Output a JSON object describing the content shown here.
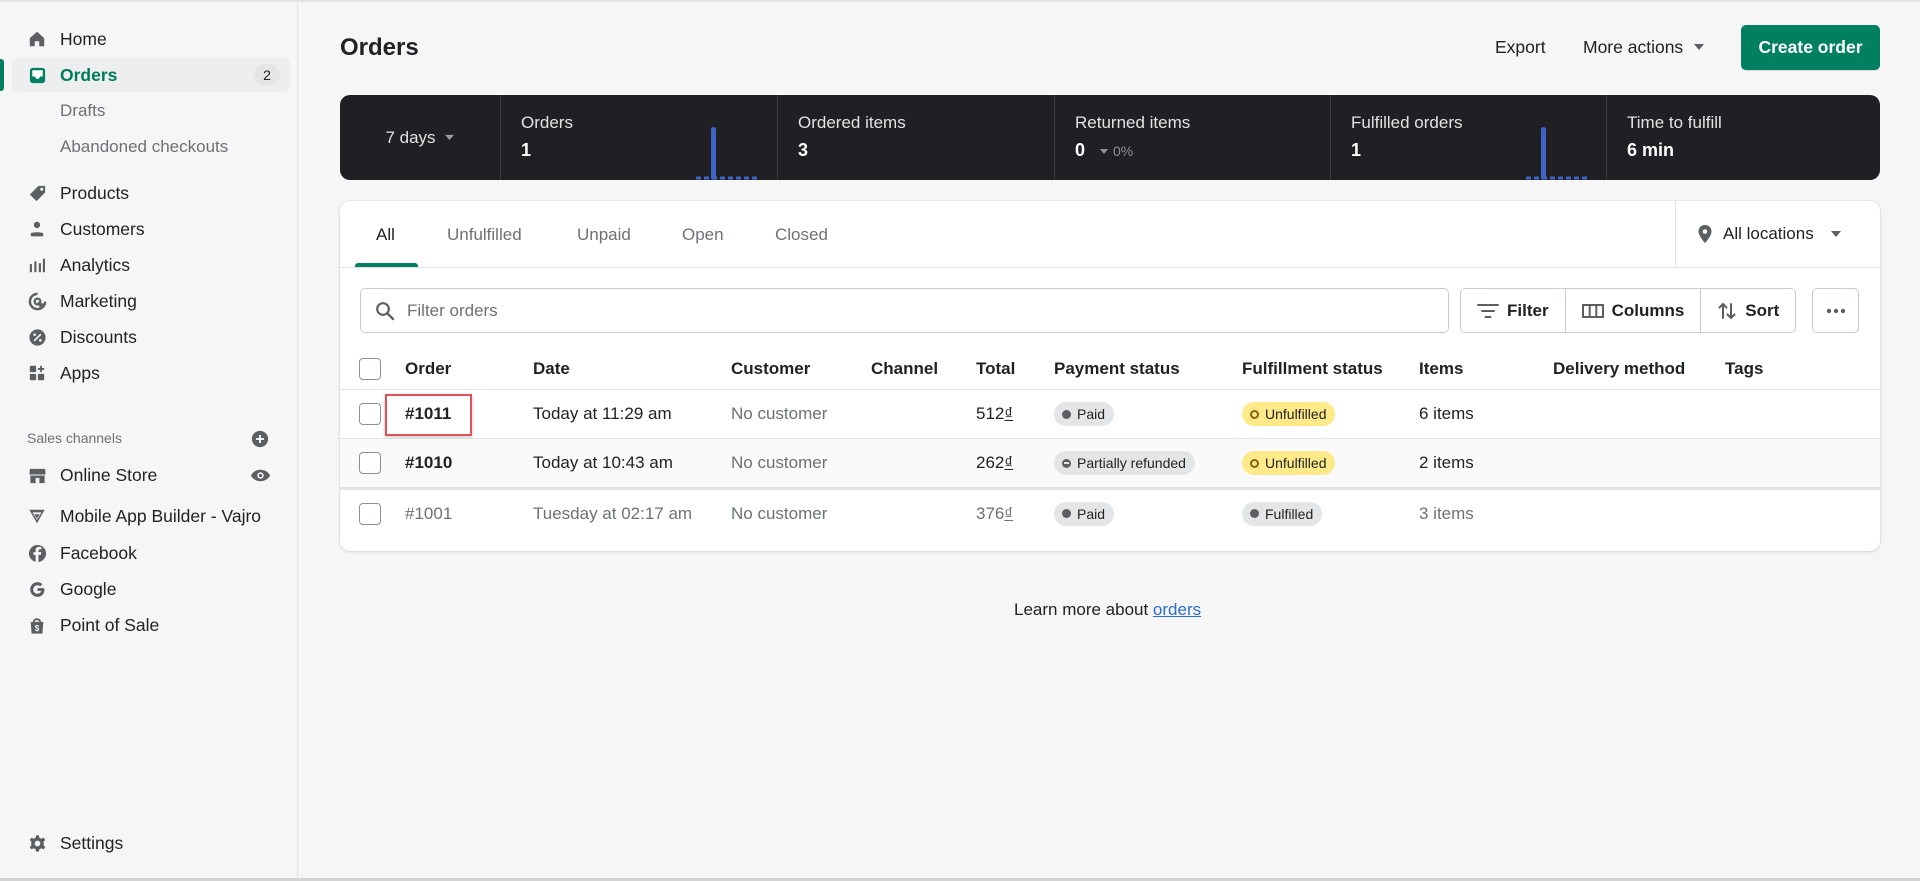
{
  "sidebar": {
    "items": [
      {
        "label": "Home",
        "icon": "home-icon"
      },
      {
        "label": "Orders",
        "icon": "orders-icon",
        "badge": "2",
        "active": true
      },
      {
        "label": "Products",
        "icon": "tag-icon"
      },
      {
        "label": "Customers",
        "icon": "person-icon"
      },
      {
        "label": "Analytics",
        "icon": "bar-chart-icon"
      },
      {
        "label": "Marketing",
        "icon": "target-icon"
      },
      {
        "label": "Discounts",
        "icon": "discount-icon"
      },
      {
        "label": "Apps",
        "icon": "apps-icon"
      }
    ],
    "order_subitems": [
      "Drafts",
      "Abandoned checkouts"
    ],
    "sales_channels_label": "Sales channels",
    "channels": [
      {
        "label": "Online Store",
        "icon": "store-icon"
      },
      {
        "label": "Mobile App Builder - Vajro",
        "icon": "vajro-icon"
      },
      {
        "label": "Facebook",
        "icon": "facebook-icon"
      },
      {
        "label": "Google",
        "icon": "google-icon"
      },
      {
        "label": "Point of Sale",
        "icon": "pos-bag-icon"
      }
    ],
    "settings_label": "Settings"
  },
  "header": {
    "title": "Orders",
    "export_label": "Export",
    "more_actions_label": "More actions",
    "create_label": "Create order"
  },
  "stats": {
    "range_label": "7 days",
    "cards": [
      {
        "label": "Orders",
        "value": "1"
      },
      {
        "label": "Ordered items",
        "value": "3"
      },
      {
        "label": "Returned items",
        "value": "0",
        "delta": "0%"
      },
      {
        "label": "Fulfilled orders",
        "value": "1"
      },
      {
        "label": "Time to fulfill",
        "value": "6 min"
      }
    ],
    "spark_color": "#3f64c9"
  },
  "tabs": [
    {
      "label": "All",
      "active": true
    },
    {
      "label": "Unfulfilled"
    },
    {
      "label": "Unpaid"
    },
    {
      "label": "Open"
    },
    {
      "label": "Closed"
    }
  ],
  "location_label": "All locations",
  "search": {
    "placeholder": "Filter orders",
    "value": ""
  },
  "toolbar": {
    "filter_label": "Filter",
    "columns_label": "Columns",
    "sort_label": "Sort"
  },
  "table": {
    "columns": [
      "Order",
      "Date",
      "Customer",
      "Channel",
      "Total",
      "Payment status",
      "Fulfillment status",
      "Items",
      "Delivery method",
      "Tags"
    ],
    "rows": [
      {
        "order": "#1011",
        "date": "Today at 11:29 am",
        "customer": "No customer",
        "channel": "",
        "total": "512",
        "currency": "₫",
        "payment": "Paid",
        "fulfillment": "Unfulfilled",
        "items": "6 items",
        "delivery": "",
        "tags": ""
      },
      {
        "order": "#1010",
        "date": "Today at 10:43 am",
        "customer": "No customer",
        "channel": "",
        "total": "262",
        "currency": "₫",
        "payment": "Partially refunded",
        "fulfillment": "Unfulfilled",
        "items": "2 items",
        "delivery": "",
        "tags": ""
      },
      {
        "order": "#1001",
        "date": "Tuesday at 02:17 am",
        "customer": "No customer",
        "channel": "",
        "total": "376",
        "currency": "₫",
        "payment": "Paid",
        "fulfillment": "Fulfilled",
        "items": "3 items",
        "delivery": "",
        "tags": ""
      }
    ]
  },
  "footer": {
    "learn_prefix": "Learn more about ",
    "learn_link": "orders"
  },
  "colors": {
    "accent": "#008060",
    "highlight": "#e05259",
    "link": "#2c6ecb",
    "unfulfilled_badge": "#ffea8a"
  }
}
